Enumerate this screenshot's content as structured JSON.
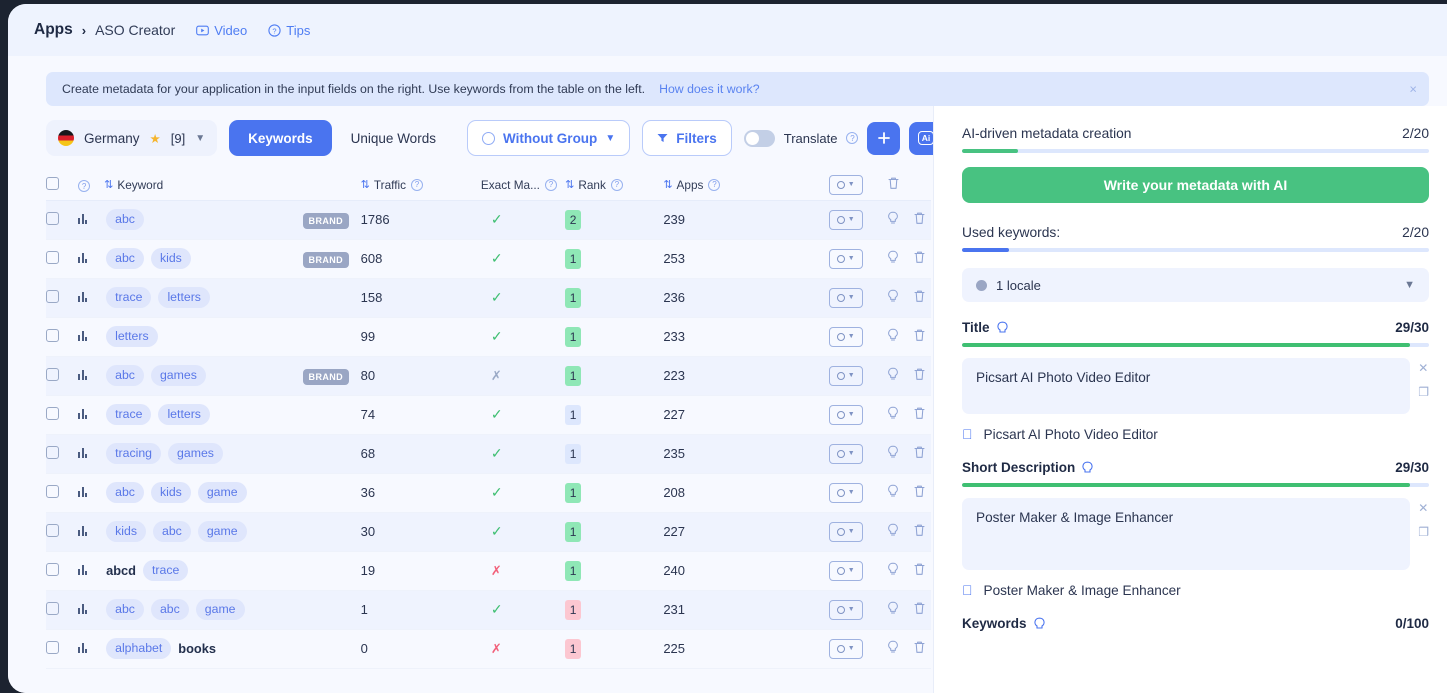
{
  "breadcrumb": {
    "root": "Apps",
    "separator": "›",
    "current": "ASO Creator",
    "video_label": "Video",
    "tips_label": "Tips"
  },
  "banner": {
    "text": "Create metadata for your application in the input fields on the right. Use keywords from the table on the left.",
    "link": "How does it work?",
    "close": "×"
  },
  "toolbar": {
    "country": "Germany",
    "favorites": "[9]",
    "star": "★",
    "tab_keywords": "Keywords",
    "tab_unique_words": "Unique Words",
    "group_filter": "Without Group",
    "filters": "Filters",
    "translate_label": "Translate",
    "add_label": "+",
    "ai_label": "Ai"
  },
  "table": {
    "headers": {
      "keyword": "Keyword",
      "traffic": "Traffic",
      "exact_match": "Exact Ma...",
      "rank": "Rank",
      "apps": "Apps"
    },
    "rows": [
      {
        "tags": [
          {
            "t": "abc",
            "styled": true
          }
        ],
        "brand": "BRAND",
        "traffic": "1786",
        "exact": "check",
        "rank": "2",
        "rank_color": "green",
        "apps": "239"
      },
      {
        "tags": [
          {
            "t": "abc",
            "styled": true
          },
          {
            "t": "kids",
            "styled": true
          }
        ],
        "brand": "BRAND",
        "traffic": "608",
        "exact": "check",
        "rank": "1",
        "rank_color": "green",
        "apps": "253"
      },
      {
        "tags": [
          {
            "t": "trace",
            "styled": true
          },
          {
            "t": "letters",
            "styled": true
          }
        ],
        "brand": "",
        "traffic": "158",
        "exact": "check",
        "rank": "1",
        "rank_color": "green",
        "apps": "236"
      },
      {
        "tags": [
          {
            "t": "letters",
            "styled": true
          }
        ],
        "brand": "",
        "traffic": "99",
        "exact": "check",
        "rank": "1",
        "rank_color": "green",
        "apps": "233"
      },
      {
        "tags": [
          {
            "t": "abc",
            "styled": true
          },
          {
            "t": "games",
            "styled": true
          }
        ],
        "brand": "BRAND",
        "traffic": "80",
        "exact": "cross",
        "rank": "1",
        "rank_color": "green",
        "apps": "223"
      },
      {
        "tags": [
          {
            "t": "trace",
            "styled": true
          },
          {
            "t": "letters",
            "styled": true
          }
        ],
        "brand": "",
        "traffic": "74",
        "exact": "check",
        "rank": "1",
        "rank_color": "blue",
        "apps": "227"
      },
      {
        "tags": [
          {
            "t": "tracing",
            "styled": true
          },
          {
            "t": "games",
            "styled": true
          }
        ],
        "brand": "",
        "traffic": "68",
        "exact": "check",
        "rank": "1",
        "rank_color": "blue",
        "apps": "235"
      },
      {
        "tags": [
          {
            "t": "abc",
            "styled": true
          },
          {
            "t": "kids",
            "styled": true
          },
          {
            "t": "game",
            "styled": true
          }
        ],
        "brand": "",
        "traffic": "36",
        "exact": "check",
        "rank": "1",
        "rank_color": "green",
        "apps": "208"
      },
      {
        "tags": [
          {
            "t": "kids",
            "styled": true
          },
          {
            "t": "abc",
            "styled": true
          },
          {
            "t": "game",
            "styled": true
          }
        ],
        "brand": "",
        "traffic": "30",
        "exact": "check",
        "rank": "1",
        "rank_color": "green",
        "apps": "227"
      },
      {
        "tags": [
          {
            "t": "abcd",
            "styled": false
          },
          {
            "t": "trace",
            "styled": true
          }
        ],
        "brand": "",
        "traffic": "19",
        "exact": "cross-red",
        "rank": "1",
        "rank_color": "green",
        "apps": "240"
      },
      {
        "tags": [
          {
            "t": "abc",
            "styled": true
          },
          {
            "t": "abc",
            "styled": true
          },
          {
            "t": "game",
            "styled": true
          }
        ],
        "brand": "",
        "traffic": "1",
        "exact": "check",
        "rank": "1",
        "rank_color": "pink",
        "apps": "231"
      },
      {
        "tags": [
          {
            "t": "alphabet",
            "styled": true
          },
          {
            "t": "books",
            "styled": false
          }
        ],
        "brand": "",
        "traffic": "0",
        "exact": "cross-red",
        "rank": "1",
        "rank_color": "pink",
        "apps": "225"
      }
    ]
  },
  "sidebar": {
    "ai_creation_label": "AI-driven metadata creation",
    "ai_creation_count": "2/20",
    "ai_creation_pct": 12,
    "ai_button": "Write your metadata with AI",
    "used_keywords_label": "Used keywords:",
    "used_keywords_count": "2/20",
    "used_keywords_pct": 10,
    "locale": "1 locale",
    "fields": [
      {
        "name": "Title",
        "count": "29/30",
        "pct": 96,
        "value": "Picsart AI Photo Video Editor",
        "preview": "Picsart AI Photo Video Editor"
      },
      {
        "name": "Short Description",
        "count": "29/30",
        "pct": 96,
        "value": "Poster Maker & Image Enhancer",
        "preview": "Poster Maker & Image Enhancer"
      }
    ],
    "keywords_field": {
      "name": "Keywords",
      "count": "0/100"
    }
  },
  "colors": {
    "accent_blue": "#4a74ef",
    "green": "#48c281",
    "rank_green": "#8fe7b6",
    "rank_pink": "#fcc7d1"
  }
}
